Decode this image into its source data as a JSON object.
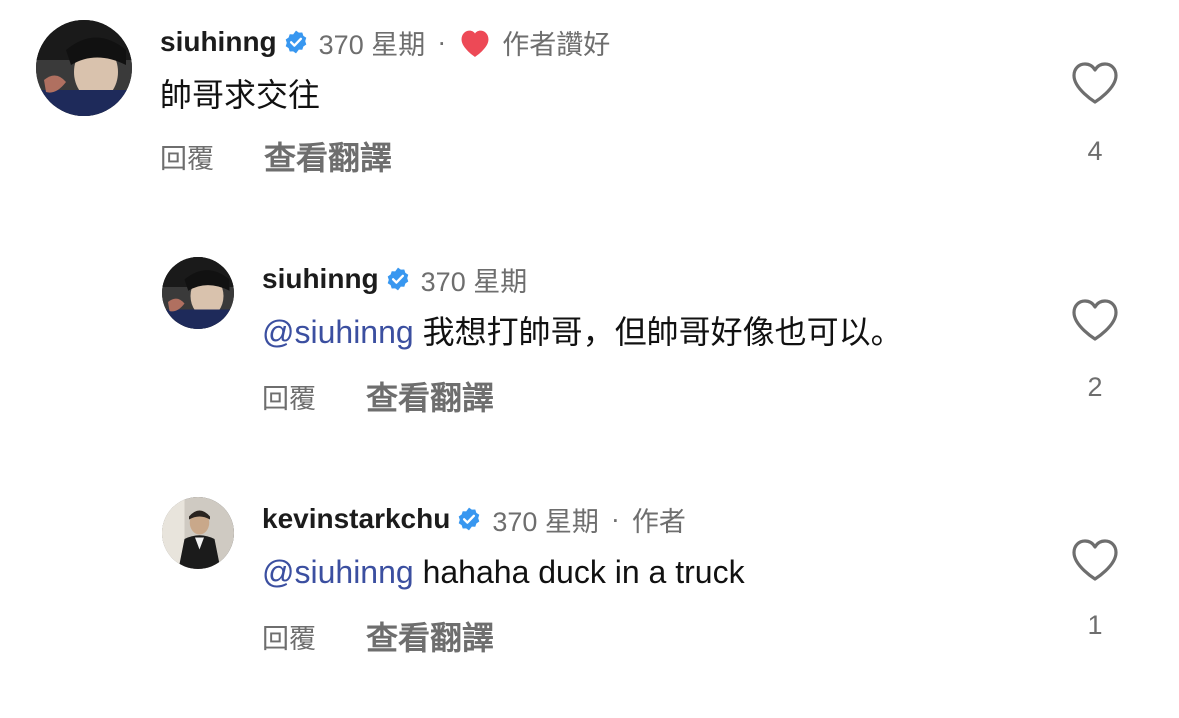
{
  "comments": [
    {
      "username": "siuhinng",
      "time": "370 星期",
      "separator": "·",
      "author_tag": "作者讚好",
      "mention": "",
      "text": "帥哥求交往",
      "reply_label": "回覆",
      "translate_label": "查看翻譯",
      "like_count": "4"
    },
    {
      "username": "siuhinng",
      "time": "370 星期",
      "mention": "@siuhinng",
      "text": " 我想打帥哥，但帥哥好像也可以。",
      "reply_label": "回覆",
      "translate_label": "查看翻譯",
      "like_count": "2"
    },
    {
      "username": "kevinstarkchu",
      "time": "370 星期",
      "separator": "·",
      "author_tag": "作者",
      "mention": "@siuhinng",
      "text": " hahaha duck in a truck",
      "reply_label": "回覆",
      "translate_label": "查看翻譯",
      "like_count": "1"
    }
  ],
  "colors": {
    "verified": "#3897f0",
    "heart_red": "#ed4956",
    "mention": "#3b4fa0",
    "muted": "#6e6e6e"
  }
}
